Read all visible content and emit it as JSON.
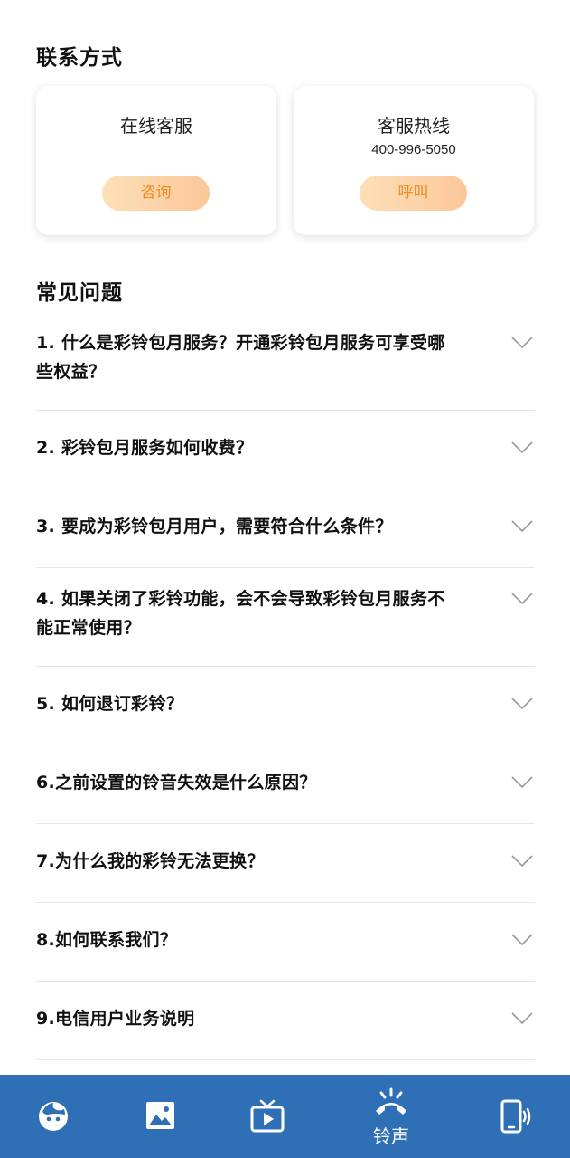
{
  "contact": {
    "title": "联系方式",
    "online": {
      "title": "在线客服",
      "button": "咨询"
    },
    "hotline": {
      "title": "客服热线",
      "phone": "400-996-5050",
      "button": "呼叫"
    }
  },
  "faq": {
    "title": "常见问题",
    "items": [
      {
        "q": "1. 什么是彩铃包月服务？开通彩铃包月服务可享受哪些权益？"
      },
      {
        "q": "2. 彩铃包月服务如何收费？"
      },
      {
        "q": "3. 要成为彩铃包月用户，需要符合什么条件？"
      },
      {
        "q": "4. 如果关闭了彩铃功能，会不会导致彩铃包月服务不能正常使用？"
      },
      {
        "q": "5. 如何退订彩铃？"
      },
      {
        "q": "6.之前设置的铃音失效是什么原因？"
      },
      {
        "q": "7.为什么我的彩铃无法更换？"
      },
      {
        "q": "8.如何联系我们？"
      },
      {
        "q": "9.电信用户业务说明"
      }
    ]
  },
  "nav": {
    "items": [
      {
        "icon": "face-icon",
        "label": ""
      },
      {
        "icon": "image-icon",
        "label": ""
      },
      {
        "icon": "tv-play-icon",
        "label": ""
      },
      {
        "icon": "ringing-phone-icon",
        "label": "铃声",
        "active": true
      },
      {
        "icon": "mobile-vibrate-icon",
        "label": ""
      }
    ],
    "color": "#2f6fb5"
  },
  "colors": {
    "accent": "#ef8a1e",
    "pill_start": "#fde0b8",
    "pill_end": "#fbc79a"
  }
}
